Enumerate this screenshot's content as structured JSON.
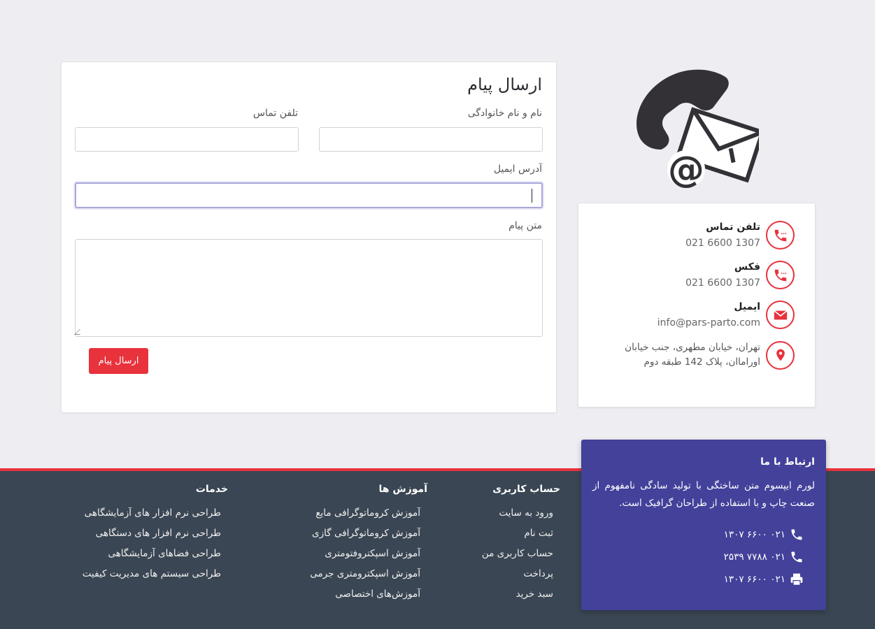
{
  "form": {
    "title": "ارسال پیام",
    "name_label": "نام و نام خانوادگی",
    "phone_label": "تلفن تماس",
    "email_label": "آدرس ایمیل",
    "message_label": "متن پیام",
    "submit_label": "ارسال پیام"
  },
  "info": {
    "phone_title": "تلفن تماس",
    "phone_value": "021 6600 1307",
    "fax_title": "فکس",
    "fax_value": "021 6600 1307",
    "email_title": "ایمیل",
    "email_value": "info@pars-parto.com",
    "address": "تهران، خیابان مطهری، جنب خیابان اوراماان، پلاک 142 طبقه دوم"
  },
  "footer": {
    "contact": {
      "title": "ارتباط با ما",
      "text": "لورم ایپسوم متن ساختگی با تولید سادگی نامفهوم از صنعت چاپ و با استفاده از طراحان گرافیک است.",
      "phone1": "۰۲۱ ۶۶۰۰ ۱۳۰۷",
      "phone2": "۰۲۱ ۷۷۸۸ ۲۵۳۹",
      "fax": "۰۲۱ ۶۶۰۰ ۱۳۰۷"
    },
    "account": {
      "title": "حساب کاربری",
      "items": [
        "ورود به سایت",
        "ثبت نام",
        "حساب کاربری من",
        "پرداخت",
        "سبد خرید"
      ]
    },
    "education": {
      "title": "آموزش ها",
      "items": [
        "آموزش کروماتوگرافی مایع",
        "آموزش کروماتوگرافی گازی",
        "آموزش اسپکتروفتومتری",
        "آموزش اسپکترومتری جرمی",
        "آموزش‌های اختصاصی"
      ]
    },
    "services": {
      "title": "خدمات",
      "items": [
        "طراحی نرم افزار های آزمایشگاهی",
        "طراحی نرم افزار های دستگاهی",
        "طراحی فضاهای آزمایشگاهی",
        "طراحی سیستم های مدیریت کیفیت"
      ]
    }
  },
  "colors": {
    "accent": "#e8323c",
    "footer_bg": "#3a4653",
    "contact_box_bg": "#43419a",
    "page_bg": "#eeeef2"
  }
}
